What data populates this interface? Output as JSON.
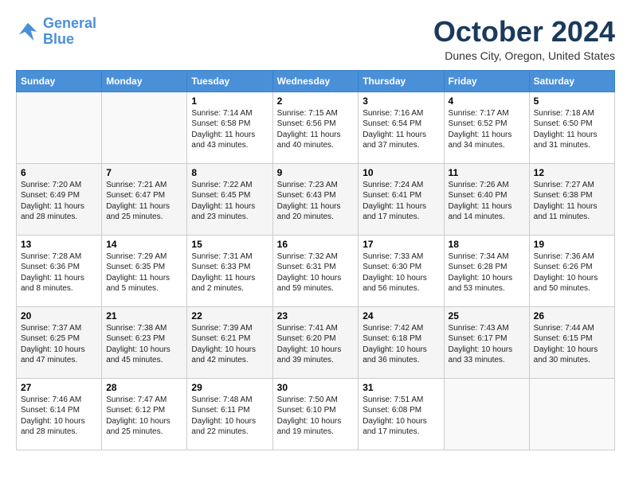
{
  "header": {
    "logo_line1": "General",
    "logo_line2": "Blue",
    "month": "October 2024",
    "location": "Dunes City, Oregon, United States"
  },
  "days_of_week": [
    "Sunday",
    "Monday",
    "Tuesday",
    "Wednesday",
    "Thursday",
    "Friday",
    "Saturday"
  ],
  "weeks": [
    [
      {
        "day": "",
        "info": ""
      },
      {
        "day": "",
        "info": ""
      },
      {
        "day": "1",
        "info": "Sunrise: 7:14 AM\nSunset: 6:58 PM\nDaylight: 11 hours and 43 minutes."
      },
      {
        "day": "2",
        "info": "Sunrise: 7:15 AM\nSunset: 6:56 PM\nDaylight: 11 hours and 40 minutes."
      },
      {
        "day": "3",
        "info": "Sunrise: 7:16 AM\nSunset: 6:54 PM\nDaylight: 11 hours and 37 minutes."
      },
      {
        "day": "4",
        "info": "Sunrise: 7:17 AM\nSunset: 6:52 PM\nDaylight: 11 hours and 34 minutes."
      },
      {
        "day": "5",
        "info": "Sunrise: 7:18 AM\nSunset: 6:50 PM\nDaylight: 11 hours and 31 minutes."
      }
    ],
    [
      {
        "day": "6",
        "info": "Sunrise: 7:20 AM\nSunset: 6:49 PM\nDaylight: 11 hours and 28 minutes."
      },
      {
        "day": "7",
        "info": "Sunrise: 7:21 AM\nSunset: 6:47 PM\nDaylight: 11 hours and 25 minutes."
      },
      {
        "day": "8",
        "info": "Sunrise: 7:22 AM\nSunset: 6:45 PM\nDaylight: 11 hours and 23 minutes."
      },
      {
        "day": "9",
        "info": "Sunrise: 7:23 AM\nSunset: 6:43 PM\nDaylight: 11 hours and 20 minutes."
      },
      {
        "day": "10",
        "info": "Sunrise: 7:24 AM\nSunset: 6:41 PM\nDaylight: 11 hours and 17 minutes."
      },
      {
        "day": "11",
        "info": "Sunrise: 7:26 AM\nSunset: 6:40 PM\nDaylight: 11 hours and 14 minutes."
      },
      {
        "day": "12",
        "info": "Sunrise: 7:27 AM\nSunset: 6:38 PM\nDaylight: 11 hours and 11 minutes."
      }
    ],
    [
      {
        "day": "13",
        "info": "Sunrise: 7:28 AM\nSunset: 6:36 PM\nDaylight: 11 hours and 8 minutes."
      },
      {
        "day": "14",
        "info": "Sunrise: 7:29 AM\nSunset: 6:35 PM\nDaylight: 11 hours and 5 minutes."
      },
      {
        "day": "15",
        "info": "Sunrise: 7:31 AM\nSunset: 6:33 PM\nDaylight: 11 hours and 2 minutes."
      },
      {
        "day": "16",
        "info": "Sunrise: 7:32 AM\nSunset: 6:31 PM\nDaylight: 10 hours and 59 minutes."
      },
      {
        "day": "17",
        "info": "Sunrise: 7:33 AM\nSunset: 6:30 PM\nDaylight: 10 hours and 56 minutes."
      },
      {
        "day": "18",
        "info": "Sunrise: 7:34 AM\nSunset: 6:28 PM\nDaylight: 10 hours and 53 minutes."
      },
      {
        "day": "19",
        "info": "Sunrise: 7:36 AM\nSunset: 6:26 PM\nDaylight: 10 hours and 50 minutes."
      }
    ],
    [
      {
        "day": "20",
        "info": "Sunrise: 7:37 AM\nSunset: 6:25 PM\nDaylight: 10 hours and 47 minutes."
      },
      {
        "day": "21",
        "info": "Sunrise: 7:38 AM\nSunset: 6:23 PM\nDaylight: 10 hours and 45 minutes."
      },
      {
        "day": "22",
        "info": "Sunrise: 7:39 AM\nSunset: 6:21 PM\nDaylight: 10 hours and 42 minutes."
      },
      {
        "day": "23",
        "info": "Sunrise: 7:41 AM\nSunset: 6:20 PM\nDaylight: 10 hours and 39 minutes."
      },
      {
        "day": "24",
        "info": "Sunrise: 7:42 AM\nSunset: 6:18 PM\nDaylight: 10 hours and 36 minutes."
      },
      {
        "day": "25",
        "info": "Sunrise: 7:43 AM\nSunset: 6:17 PM\nDaylight: 10 hours and 33 minutes."
      },
      {
        "day": "26",
        "info": "Sunrise: 7:44 AM\nSunset: 6:15 PM\nDaylight: 10 hours and 30 minutes."
      }
    ],
    [
      {
        "day": "27",
        "info": "Sunrise: 7:46 AM\nSunset: 6:14 PM\nDaylight: 10 hours and 28 minutes."
      },
      {
        "day": "28",
        "info": "Sunrise: 7:47 AM\nSunset: 6:12 PM\nDaylight: 10 hours and 25 minutes."
      },
      {
        "day": "29",
        "info": "Sunrise: 7:48 AM\nSunset: 6:11 PM\nDaylight: 10 hours and 22 minutes."
      },
      {
        "day": "30",
        "info": "Sunrise: 7:50 AM\nSunset: 6:10 PM\nDaylight: 10 hours and 19 minutes."
      },
      {
        "day": "31",
        "info": "Sunrise: 7:51 AM\nSunset: 6:08 PM\nDaylight: 10 hours and 17 minutes."
      },
      {
        "day": "",
        "info": ""
      },
      {
        "day": "",
        "info": ""
      }
    ]
  ]
}
